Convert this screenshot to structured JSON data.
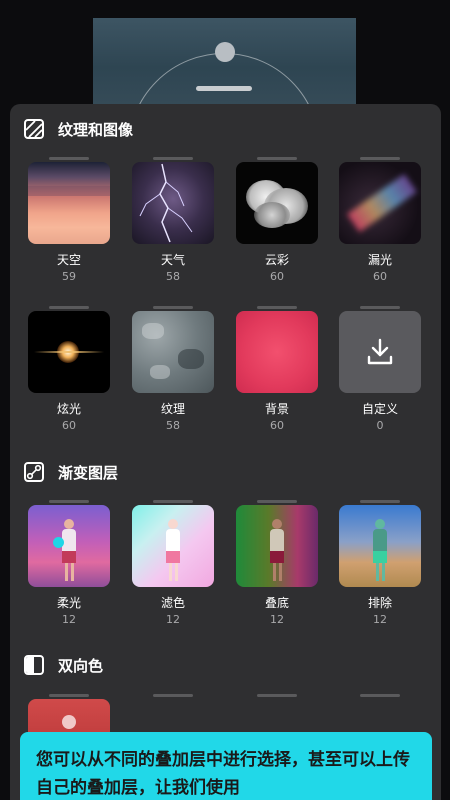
{
  "sections": {
    "textures": {
      "title": "纹理和图像"
    },
    "gradient": {
      "title": "渐变图层"
    },
    "duotone": {
      "title": "双向色"
    }
  },
  "textures_items": [
    {
      "label": "天空",
      "count": "59",
      "icon": "sky-thumbnail"
    },
    {
      "label": "天气",
      "count": "58",
      "icon": "lightning-thumbnail"
    },
    {
      "label": "云彩",
      "count": "60",
      "icon": "cloud-thumbnail"
    },
    {
      "label": "漏光",
      "count": "60",
      "icon": "light-leak-thumbnail"
    },
    {
      "label": "炫光",
      "count": "60",
      "icon": "flare-thumbnail"
    },
    {
      "label": "纹理",
      "count": "58",
      "icon": "texture-thumbnail"
    },
    {
      "label": "背景",
      "count": "60",
      "icon": "background-thumbnail"
    },
    {
      "label": "自定义",
      "count": "0",
      "icon": "download-icon"
    }
  ],
  "gradient_items": [
    {
      "label": "柔光",
      "count": "12"
    },
    {
      "label": "滤色",
      "count": "12"
    },
    {
      "label": "叠底",
      "count": "12"
    },
    {
      "label": "排除",
      "count": "12"
    }
  ],
  "tooltip": {
    "text": "您可以从不同的叠加层中进行选择，甚至可以上传自己的叠加层，让我们使用"
  },
  "colors": {
    "sheet": "#2f2f31",
    "accent": "#21d8e8"
  }
}
